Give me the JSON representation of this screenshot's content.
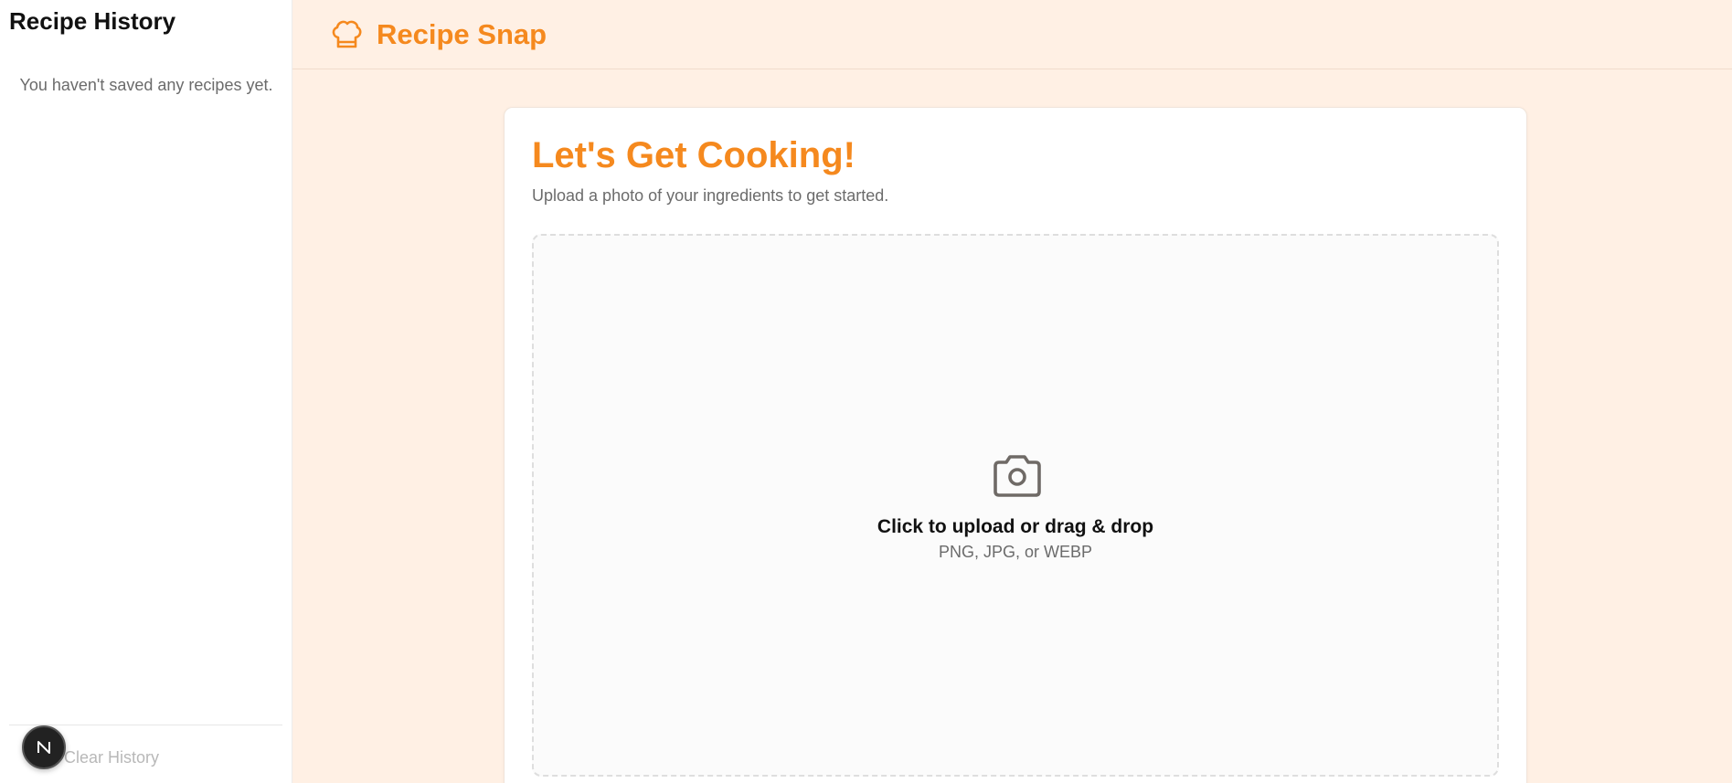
{
  "sidebar": {
    "title": "Recipe History",
    "empty_message": "You haven't saved any recipes yet.",
    "clear_label": "Clear History",
    "badge_letter": "N"
  },
  "header": {
    "app_name": "Recipe Snap",
    "logo_icon": "chef-hat-icon"
  },
  "main": {
    "title": "Let's Get Cooking!",
    "subtitle": "Upload a photo of your ingredients to get started.",
    "upload": {
      "icon": "camera-icon",
      "primary": "Click to upload or drag & drop",
      "formats": "PNG, JPG, or WEBP"
    }
  },
  "colors": {
    "accent": "#f5891e",
    "background": "#fff0e4"
  }
}
